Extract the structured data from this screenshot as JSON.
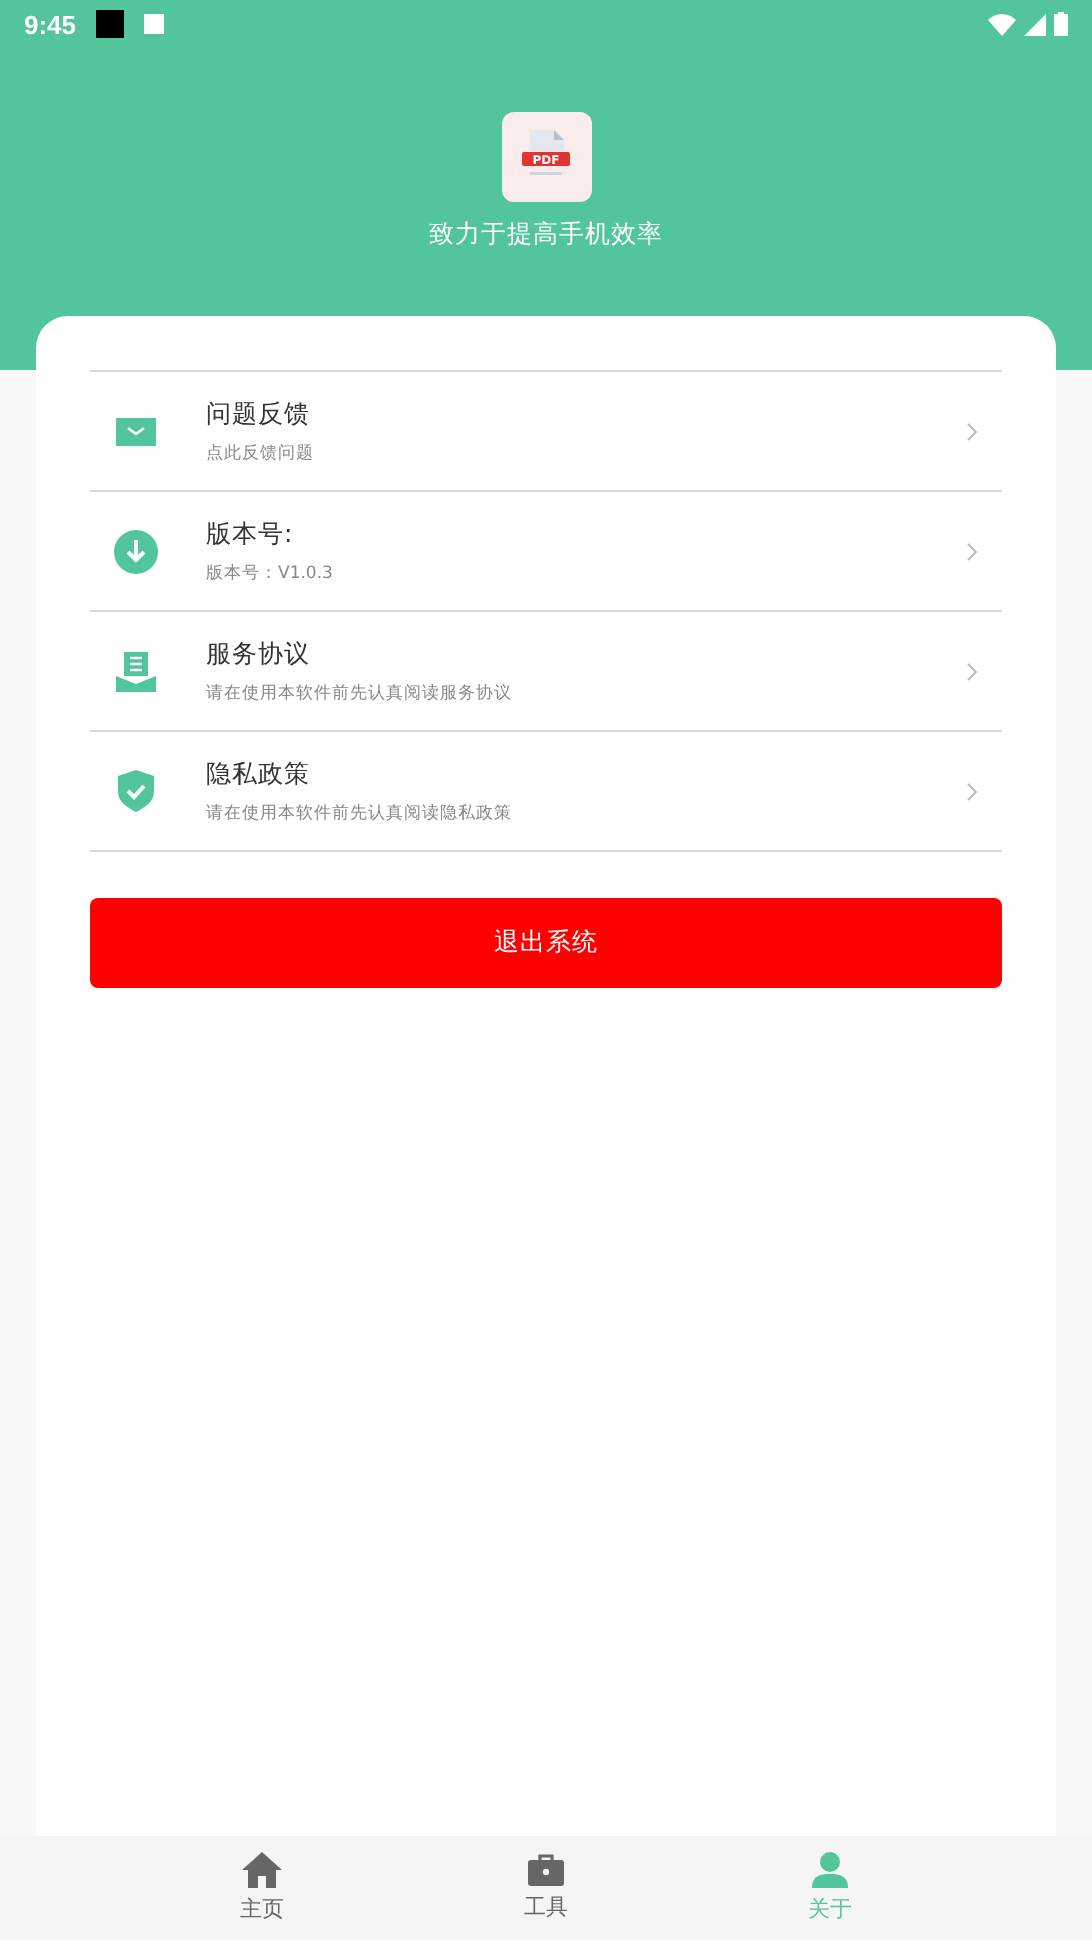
{
  "status_bar": {
    "time": "9:45"
  },
  "header": {
    "logo_text": "PDF",
    "slogan": "致力于提高手机效率"
  },
  "menu": [
    {
      "kind": "mail",
      "title": "问题反馈",
      "subtitle": "点此反馈问题"
    },
    {
      "kind": "download",
      "title": "版本号:",
      "subtitle": "版本号：V1.0.3"
    },
    {
      "kind": "document",
      "title": "服务协议",
      "subtitle": "请在使用本软件前先认真阅读服务协议"
    },
    {
      "kind": "shield",
      "title": "隐私政策",
      "subtitle": "请在使用本软件前先认真阅读隐私政策"
    }
  ],
  "logout_button": "退出系统",
  "bottom_nav": [
    {
      "kind": "home",
      "label": "主页",
      "selected": false
    },
    {
      "kind": "toolbox",
      "label": "工具",
      "selected": false
    },
    {
      "kind": "person",
      "label": "关于",
      "selected": true
    }
  ]
}
